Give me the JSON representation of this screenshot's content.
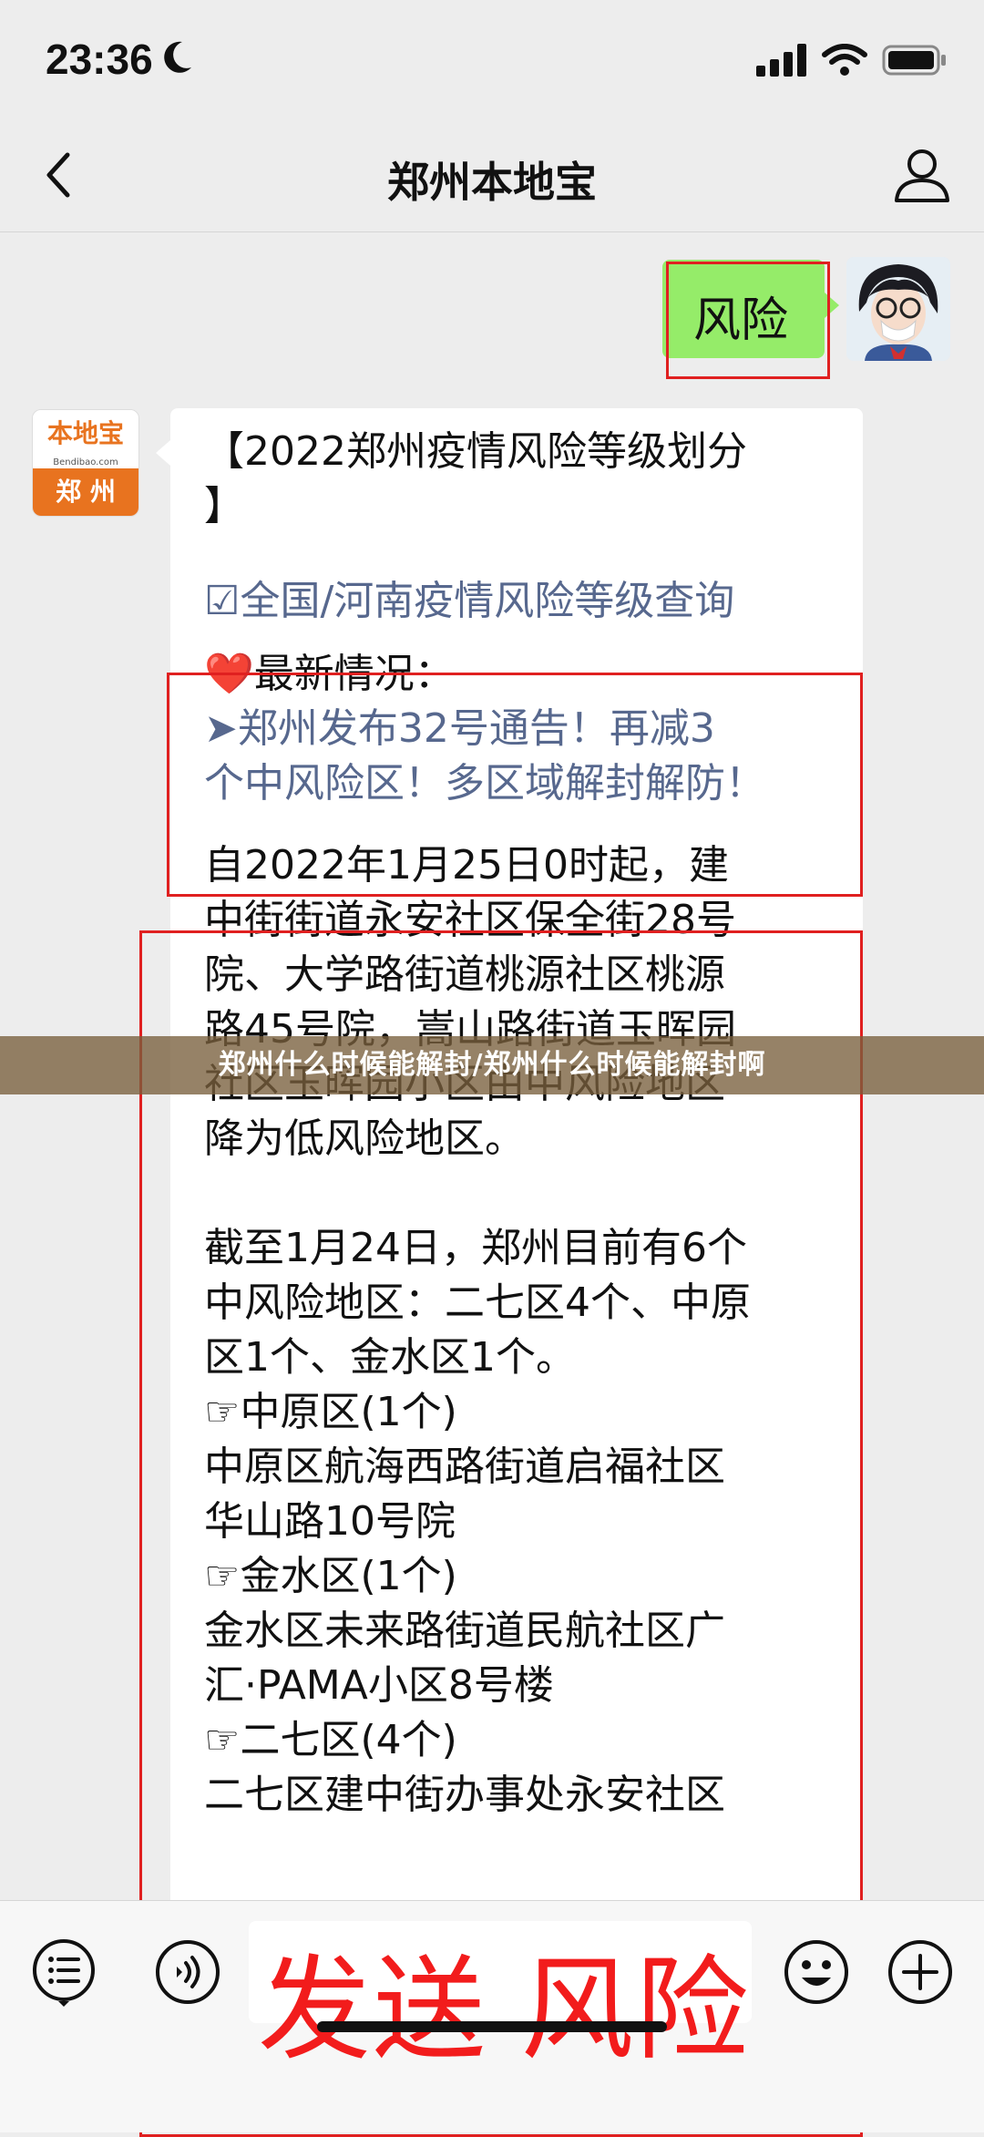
{
  "status_bar": {
    "time": "23:36"
  },
  "nav": {
    "title": "郑州本地宝"
  },
  "chat": {
    "my_message": "风险",
    "bot_logo": {
      "top": "本地宝",
      "sub": "Bendibao.com",
      "bottom": "郑 州"
    },
    "heading_line1": "【2022郑州疫情风险等级划分",
    "heading_line2": "】",
    "query_link": "☑全国/河南疫情风险等级查询",
    "latest_label": "❤️最新情况：",
    "latest_link_line1": "➤郑州发布32号通告！再减3",
    "latest_link_line2": "个中风险区！多区域解封解防！",
    "body_lines": [
      "自2022年1月25日0时起，建",
      "中街街道永安社区保全街28号",
      "院、大学路街道桃源社区桃源",
      "路45号院，嵩山路街道玉晖园",
      "社区玉晖园小区由中风险地区",
      "降为低风险地区。",
      "",
      "截至1月24日，郑州目前有6个",
      "中风险地区：二七区4个、中原",
      "区1个、金水区1个。",
      "☞中原区(1个)",
      "中原区航海西路街道启福社区",
      "华山路10号院",
      "☞金水区(1个)",
      "金水区未来路街道民航社区广",
      "汇·PAMA小区8号楼",
      "☞二七区(4个)",
      "二七区建中街办事处永安社区"
    ]
  },
  "watermark": "郑州什么时候能解封/郑州什么时候能解封啊",
  "input_bar": {
    "overlay_text": "发送 风险"
  },
  "colors": {
    "accent_green": "#95ec69",
    "highlight_red": "#e02020",
    "link": "#57688e"
  }
}
